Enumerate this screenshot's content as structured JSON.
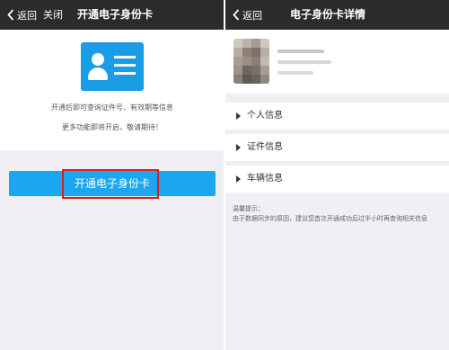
{
  "left_screen": {
    "nav": {
      "back_label": "返回",
      "close_label": "关闭",
      "title": "开通电子身份卡"
    },
    "hero": {
      "icon": "id-card-icon",
      "line1": "开通后即可查询证件号、有效期等信息",
      "line2": "更多功能即将开启，敬请期待！"
    },
    "open_button_label": "开通电子身份卡"
  },
  "right_screen": {
    "nav": {
      "back_label": "返回",
      "title": "电子身份卡详情"
    },
    "sections": [
      {
        "label": "个人信息"
      },
      {
        "label": "证件信息"
      },
      {
        "label": "车辆信息"
      }
    ],
    "tip_title": "温馨提示：",
    "tip_text": "由于数据同步的原因，建议您首次开通成功后过半小时再查询相关信息"
  },
  "colors": {
    "navbar": "#2b2b2b",
    "accent_blue": "#1aa7ef",
    "highlight_red": "#d32020",
    "background": "#efeff4"
  }
}
